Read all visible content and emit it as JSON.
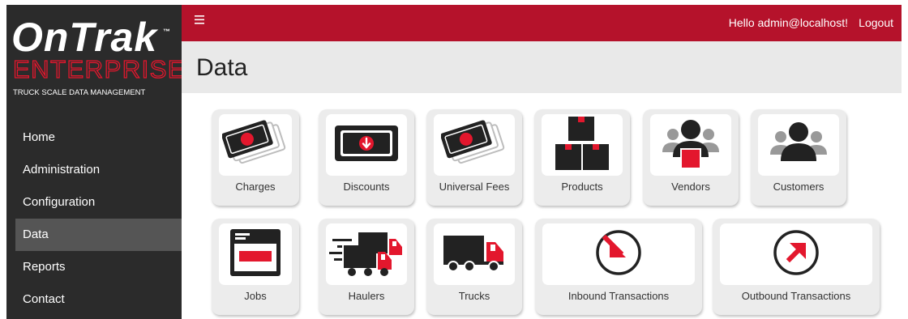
{
  "logo": {
    "brand_on": "On",
    "brand_trak": "Trak",
    "trademark": "™",
    "enterprise": "ENTERPRISE",
    "tagline": "TRUCK SCALE DATA MANAGEMENT"
  },
  "nav": {
    "items": [
      {
        "label": "Home"
      },
      {
        "label": "Administration"
      },
      {
        "label": "Configuration"
      },
      {
        "label": "Data"
      },
      {
        "label": "Reports"
      },
      {
        "label": "Contact"
      }
    ],
    "active": "Data"
  },
  "topbar": {
    "menu_icon": "hamburger-icon",
    "greeting": "Hello admin@localhost!",
    "logout_label": "Logout"
  },
  "page": {
    "title": "Data"
  },
  "tiles": [
    {
      "label": "Charges",
      "icon": "charges-icon"
    },
    {
      "label": "Discounts",
      "icon": "discounts-icon"
    },
    {
      "label": "Universal Fees",
      "icon": "universal-fees-icon"
    },
    {
      "label": "Products",
      "icon": "products-icon"
    },
    {
      "label": "Vendors",
      "icon": "vendors-icon"
    },
    {
      "label": "Customers",
      "icon": "customers-icon"
    },
    {
      "label": "Jobs",
      "icon": "jobs-icon"
    },
    {
      "label": "Haulers",
      "icon": "haulers-icon"
    },
    {
      "label": "Trucks",
      "icon": "trucks-icon"
    },
    {
      "label": "Inbound Transactions",
      "icon": "inbound-transactions-icon"
    },
    {
      "label": "Outbound Transactions",
      "icon": "outbound-transactions-icon"
    }
  ],
  "colors": {
    "accent_red": "#b5122b",
    "icon_red": "#e3172d",
    "sidebar": "#2b2b2b",
    "title_band": "#e9e9e9"
  }
}
